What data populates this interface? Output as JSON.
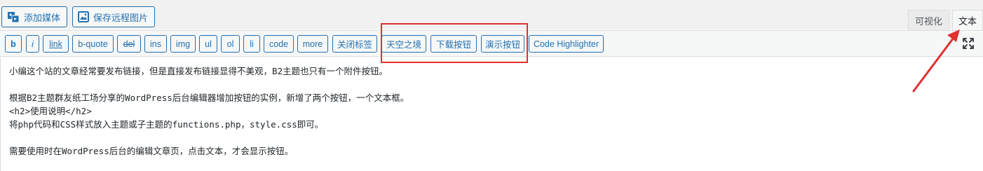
{
  "media_buttons": {
    "add_media": "添加媒体",
    "save_remote_images": "保存远程图片"
  },
  "tabs": {
    "visual": "可视化",
    "text": "文本"
  },
  "quicktags": [
    "b",
    "i",
    "link",
    "b-quote",
    "del",
    "ins",
    "img",
    "ul",
    "ol",
    "li",
    "code",
    "more",
    "关闭标签",
    "天空之境",
    "下载按钮",
    "演示按钮",
    "Code Highlighter"
  ],
  "content_lines": [
    "小编这个站的文章经常要发布链接，但是直接发布链接显得不美观，B2主题也只有一个附件按钮。",
    "",
    "根据B2主题群友纸工场分享的WordPress后台编辑器增加按钮的实例，新增了两个按钮，一个文本框。",
    "<h2>使用说明</h2>",
    "将php代码和CSS样式放入主题或子主题的functions.php，style.css即可。",
    "",
    "需要使用时在WordPress后台的编辑文章页，点击文本，才会显示按钮。"
  ],
  "colors": {
    "button_border": "#2271b1",
    "annotation_red": "#e03030"
  }
}
